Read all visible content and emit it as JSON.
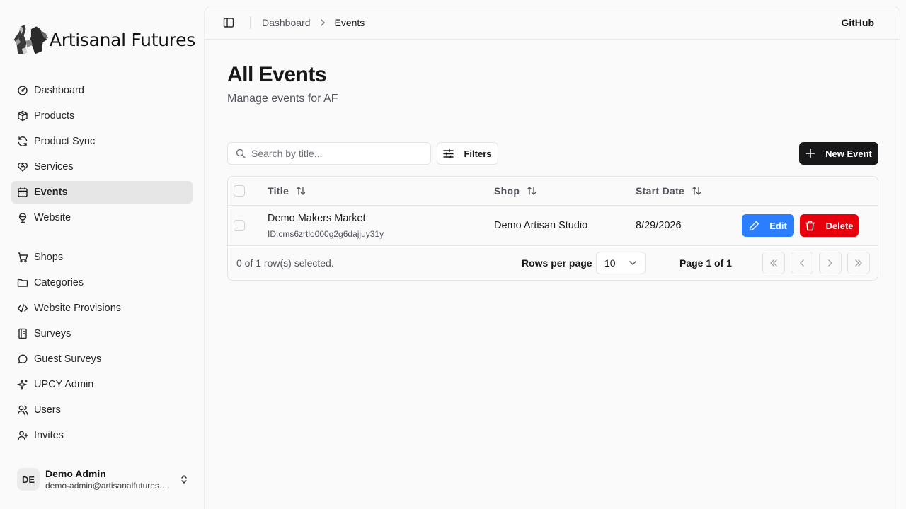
{
  "app": {
    "brand": "Artisanal Futures"
  },
  "sidebar": {
    "primary": [
      {
        "label": "Dashboard",
        "icon": "gauge-icon",
        "active": false
      },
      {
        "label": "Products",
        "icon": "package-icon",
        "active": false
      },
      {
        "label": "Product Sync",
        "icon": "refresh-icon",
        "active": false
      },
      {
        "label": "Services",
        "icon": "heart-handshake-icon",
        "active": false
      },
      {
        "label": "Events",
        "icon": "calendar-icon",
        "active": true
      },
      {
        "label": "Website",
        "icon": "globe-icon",
        "active": false
      }
    ],
    "secondary": [
      {
        "label": "Shops",
        "icon": "cart-icon"
      },
      {
        "label": "Categories",
        "icon": "folder-icon"
      },
      {
        "label": "Website Provisions",
        "icon": "code-icon"
      },
      {
        "label": "Surveys",
        "icon": "notebook-icon"
      },
      {
        "label": "Guest Surveys",
        "icon": "message-circle-icon"
      },
      {
        "label": "UPCY Admin",
        "icon": "sparkles-icon"
      },
      {
        "label": "Users",
        "icon": "users-icon"
      },
      {
        "label": "Invites",
        "icon": "user-plus-icon"
      }
    ],
    "user": {
      "initials": "DE",
      "name": "Demo Admin",
      "email": "demo-admin@artisanalfutures.org"
    }
  },
  "topbar": {
    "breadcrumb": [
      "Dashboard",
      "Events"
    ],
    "github": "GitHub"
  },
  "page": {
    "title": "All Events",
    "subtitle": "Manage events for AF"
  },
  "toolbar": {
    "search_placeholder": "Search by title...",
    "filters_label": "Filters",
    "new_label": "New Event"
  },
  "table": {
    "columns": [
      "Title",
      "Shop",
      "Start Date"
    ],
    "rows": [
      {
        "title": "Demo Makers Market",
        "id": "ID:cms6zrtlo000g2g6dajjuy31y",
        "shop": "Demo Artisan Studio",
        "start_date": "8/29/2026",
        "edit_label": "Edit",
        "delete_label": "Delete"
      }
    ],
    "footer": {
      "selected": "0 of 1 row(s) selected.",
      "rows_per_page_label": "Rows per page",
      "rows_per_page_value": "10",
      "page_info": "Page 1 of 1"
    }
  },
  "colors": {
    "primary_button": "#18181b",
    "edit_button": "#2b7fff",
    "delete_button": "#e7000b",
    "active_nav": "#e6e6e7"
  }
}
